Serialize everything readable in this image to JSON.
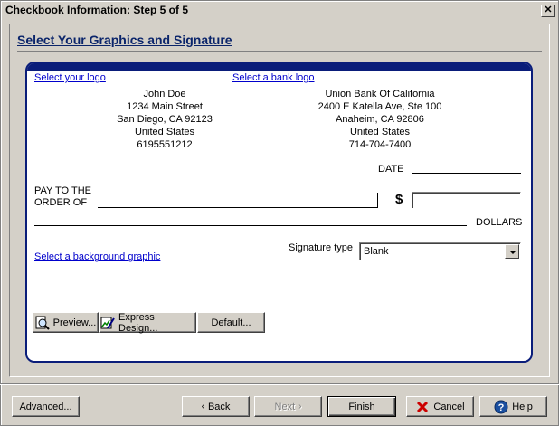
{
  "window": {
    "title": "Checkbook Information: Step 5 of 5",
    "close_glyph": "✕"
  },
  "heading": "Select Your Graphics and Signature",
  "check": {
    "select_logo_link": "Select your logo",
    "select_bank_logo_link": "Select a bank logo",
    "payer": [
      "John Doe",
      "1234 Main Street",
      "San Diego, CA 92123",
      "United States",
      "6195551212"
    ],
    "bank": [
      "Union Bank Of California",
      "2400 E Katella Ave, Ste 100",
      "Anaheim, CA 92806",
      "United States",
      "714-704-7400"
    ],
    "date_label": "DATE",
    "pay_to_line1": "PAY TO THE",
    "pay_to_line2": "ORDER OF",
    "dollar_sign": "$",
    "amount_value": "",
    "dollars_label": "DOLLARS",
    "select_background_link": "Select a background graphic",
    "signature_type_label": "Signature type",
    "signature_type_value": "Blank",
    "buttons": {
      "preview": "Preview...",
      "express_design": "Express Design...",
      "default": "Default..."
    }
  },
  "footer": {
    "advanced": "Advanced...",
    "back": "Back",
    "next": "Next",
    "finish": "Finish",
    "cancel": "Cancel",
    "help": "Help"
  },
  "icons": {
    "preview": "magnifier-page-icon",
    "express_design": "design-wand-icon",
    "back": "chevron-left-icon",
    "next": "chevron-right-icon",
    "cancel": "red-x-icon",
    "help": "help-question-icon"
  },
  "colors": {
    "accent": "#0a1d7a",
    "link": "#0000cc",
    "cancel_red": "#cc0000",
    "help_blue": "#1a4fa0"
  }
}
